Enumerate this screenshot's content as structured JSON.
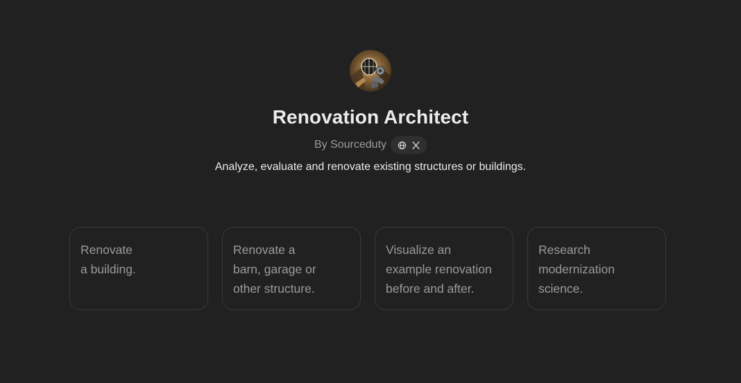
{
  "gpt": {
    "name": "Renovation Architect",
    "byline": "By Sourceduty",
    "description": "Analyze, evaluate and renovate existing structures or buildings.",
    "avatar_icon": "renovation-architect-avatar-icon",
    "links": [
      {
        "icon": "globe-icon"
      },
      {
        "icon": "x-logo-icon"
      }
    ]
  },
  "conversation_starters": [
    {
      "lines": [
        "Renovate",
        "a building."
      ]
    },
    {
      "lines": [
        "Renovate a",
        "barn, garage or",
        "other structure."
      ]
    },
    {
      "lines": [
        "Visualize an",
        "example renovation",
        "before and after."
      ]
    },
    {
      "lines": [
        "Research",
        "modernization",
        "science."
      ]
    }
  ],
  "colors": {
    "background": "#212121",
    "title_text": "#ececec",
    "muted_text": "#9b9b9b",
    "card_border": "#3a3a3a",
    "pill_background": "#2f2f2f"
  }
}
